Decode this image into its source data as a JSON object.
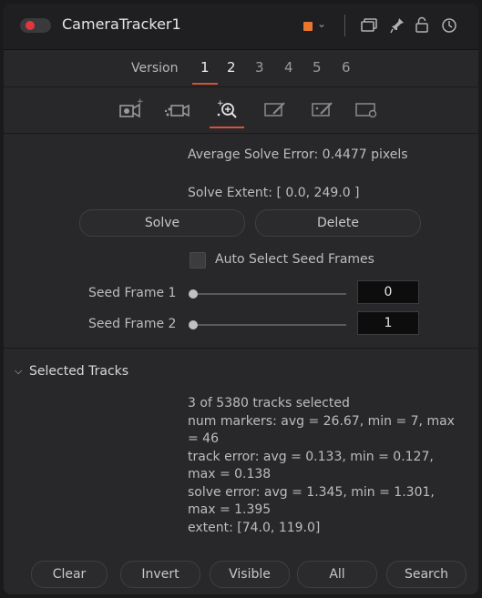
{
  "header": {
    "title": "CameraTracker1",
    "accent_color": "#e8772e",
    "enable_color": "#e0363f"
  },
  "versions": {
    "label": "Version",
    "numbers": [
      "1",
      "2",
      "3",
      "4",
      "5",
      "6"
    ],
    "active": "1"
  },
  "tabs": {
    "icons": [
      "camera-track-icon",
      "camera-solve-icon",
      "solve-magnify-icon",
      "export-icon",
      "options-icon",
      "settings-icon"
    ],
    "active": 2
  },
  "solve": {
    "avg_error": "Average Solve Error:  0.4477 pixels",
    "extent": "Solve Extent:  [ 0.0, 249.0 ]",
    "solve_button": "Solve",
    "delete_button": "Delete",
    "auto_seed_label": "Auto Select Seed Frames",
    "seed1_label": "Seed Frame 1",
    "seed1_value": "0",
    "seed2_label": "Seed Frame 2",
    "seed2_value": "1"
  },
  "selected_tracks": {
    "title": "Selected Tracks",
    "lines": [
      "3 of 5380 tracks selected",
      "num markers:  avg = 26.67, min = 7, max = 46",
      "track error:  avg = 0.133, min = 0.127, max = 0.138",
      "solve error:  avg = 1.345, min = 1.301, max = 1.395",
      "extent:  [74.0, 119.0]"
    ],
    "buttons": [
      "Clear",
      "Invert",
      "Visible",
      "All",
      "Search"
    ]
  }
}
